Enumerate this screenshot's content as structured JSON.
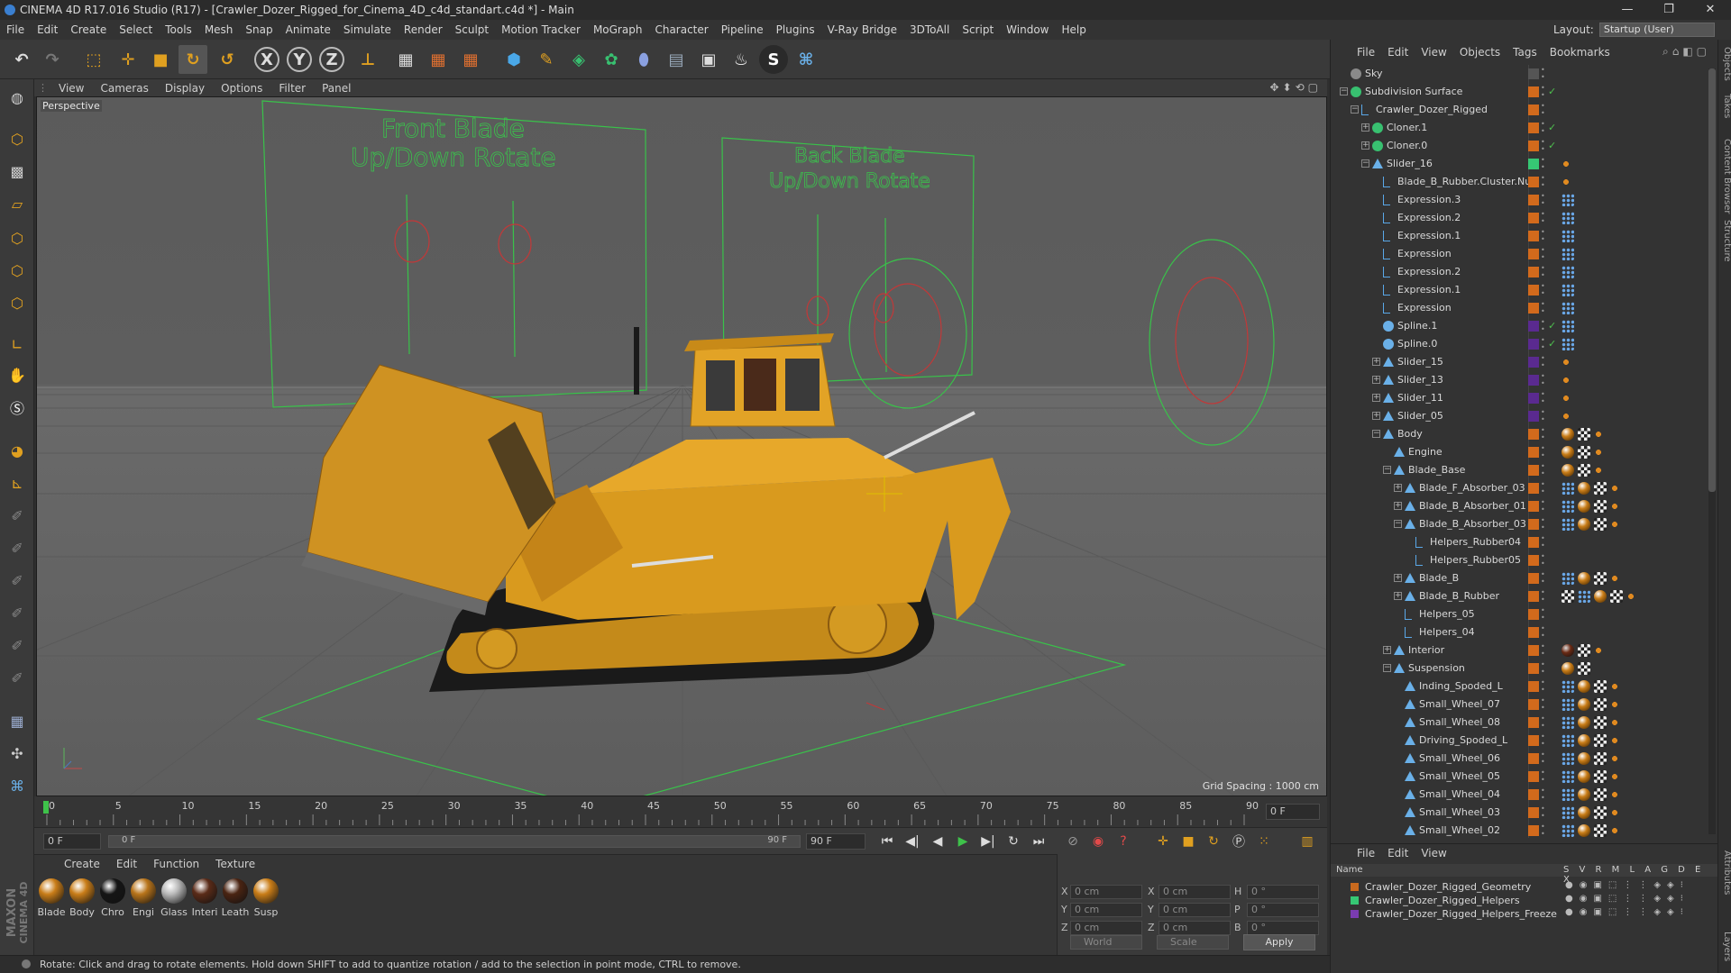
{
  "window": {
    "title": "CINEMA 4D R17.016 Studio (R17) - [Crawler_Dozer_Rigged_for_Cinema_4D_c4d_standart.c4d *] - Main",
    "controls": [
      "—",
      "❐",
      "✕"
    ]
  },
  "menubar": {
    "items": [
      "File",
      "Edit",
      "Create",
      "Select",
      "Tools",
      "Mesh",
      "Snap",
      "Animate",
      "Simulate",
      "Render",
      "Sculpt",
      "Motion Tracker",
      "MoGraph",
      "Character",
      "Pipeline",
      "Plugins",
      "V-Ray Bridge",
      "3DToAll",
      "Script",
      "Window",
      "Help"
    ]
  },
  "layout": {
    "label": "Layout:",
    "value": "Startup (User)"
  },
  "toolbar": {
    "axis_x": "X",
    "axis_y": "Y",
    "axis_z": "Z"
  },
  "viewport": {
    "menu": [
      "View",
      "Cameras",
      "Display",
      "Options",
      "Filter",
      "Panel"
    ],
    "label": "Perspective",
    "grid_spacing": "Grid Spacing : 1000 cm",
    "front_blade_line1": "Front Blade",
    "front_blade_line2": "Up/Down   Rotate",
    "back_blade_line1": "Back Blade",
    "back_blade_line2": "Up/Down   Rotate"
  },
  "timeline": {
    "ticks": [
      "0",
      "5",
      "10",
      "15",
      "20",
      "25",
      "30",
      "35",
      "40",
      "45",
      "50",
      "55",
      "60",
      "65",
      "70",
      "75",
      "80",
      "85",
      "90"
    ],
    "current_frame": "0 F"
  },
  "transport": {
    "start": "0 F",
    "range_start": "0 F",
    "range_end": "90 F",
    "end": "90 F"
  },
  "materials": {
    "menu": [
      "Create",
      "Edit",
      "Function",
      "Texture"
    ],
    "items": [
      {
        "name": "Blade",
        "color": "#c97d18"
      },
      {
        "name": "Body",
        "color": "#c97d18"
      },
      {
        "name": "Chro",
        "color": "#151515"
      },
      {
        "name": "Engi",
        "color": "#b8741a"
      },
      {
        "name": "Glass",
        "color": "#b9b9b9"
      },
      {
        "name": "Interi",
        "color": "#5a2b18"
      },
      {
        "name": "Leath",
        "color": "#4a2412"
      },
      {
        "name": "Susp",
        "color": "#c97d18"
      }
    ]
  },
  "coordinates": {
    "rows": [
      {
        "a": "X",
        "av": "0 cm",
        "b": "X",
        "bv": "0 cm",
        "c": "H",
        "cv": "0 °"
      },
      {
        "a": "Y",
        "av": "0 cm",
        "b": "Y",
        "bv": "0 cm",
        "c": "P",
        "cv": "0 °"
      },
      {
        "a": "Z",
        "av": "0 cm",
        "b": "Z",
        "bv": "0 cm",
        "c": "B",
        "cv": "0 °"
      }
    ],
    "mode": "World",
    "transform": "Scale",
    "apply": "Apply"
  },
  "status": "Rotate: Click and drag to rotate elements. Hold down SHIFT to add to quantize rotation / add to the selection in point mode, CTRL to remove.",
  "branding": {
    "maxon": "MAXON",
    "cinema": "CINEMA 4D"
  },
  "objects": {
    "menu": [
      "File",
      "Edit",
      "View",
      "Objects",
      "Tags",
      "Bookmarks"
    ],
    "items": [
      {
        "name": "Sky",
        "indent": 0,
        "exp": "",
        "icon": "sky",
        "tags": []
      },
      {
        "name": "Subdivision Surface",
        "indent": 0,
        "exp": "−",
        "icon": "subd",
        "check": "✓",
        "tags": []
      },
      {
        "name": "Crawler_Dozer_Rigged",
        "indent": 1,
        "exp": "−",
        "icon": "null",
        "tags": []
      },
      {
        "name": "Cloner.1",
        "indent": 2,
        "exp": "+",
        "icon": "cloner",
        "check": "✓",
        "tags": []
      },
      {
        "name": "Cloner.0",
        "indent": 2,
        "exp": "+",
        "icon": "cloner",
        "check": "✓",
        "tags": []
      },
      {
        "name": "Slider_16",
        "indent": 2,
        "exp": "−",
        "icon": "joint",
        "tags": [
          "xp"
        ]
      },
      {
        "name": "Blade_B_Rubber.Cluster.Null",
        "indent": 3,
        "exp": "",
        "icon": "null",
        "tags": [
          "xp"
        ]
      },
      {
        "name": "Expression.3",
        "indent": 3,
        "exp": "",
        "icon": "null",
        "tags": [
          "dots"
        ]
      },
      {
        "name": "Expression.2",
        "indent": 3,
        "exp": "",
        "icon": "null",
        "tags": [
          "dots"
        ]
      },
      {
        "name": "Expression.1",
        "indent": 3,
        "exp": "",
        "icon": "null",
        "tags": [
          "dots"
        ]
      },
      {
        "name": "Expression",
        "indent": 3,
        "exp": "",
        "icon": "null",
        "tags": [
          "dots"
        ]
      },
      {
        "name": "Expression.2",
        "indent": 3,
        "exp": "",
        "icon": "null",
        "tags": [
          "dots"
        ]
      },
      {
        "name": "Expression.1",
        "indent": 3,
        "exp": "",
        "icon": "null",
        "tags": [
          "dots"
        ]
      },
      {
        "name": "Expression",
        "indent": 3,
        "exp": "",
        "icon": "null",
        "tags": [
          "dots"
        ]
      },
      {
        "name": "Spline.1",
        "indent": 3,
        "exp": "",
        "icon": "spline",
        "check": "✓",
        "tags": [
          "dots"
        ]
      },
      {
        "name": "Spline.0",
        "indent": 3,
        "exp": "",
        "icon": "spline",
        "check": "✓",
        "tags": [
          "dots"
        ]
      },
      {
        "name": "Slider_15",
        "indent": 3,
        "exp": "+",
        "icon": "joint",
        "tags": [
          "xp"
        ]
      },
      {
        "name": "Slider_13",
        "indent": 3,
        "exp": "+",
        "icon": "joint",
        "tags": [
          "xp"
        ]
      },
      {
        "name": "Slider_11",
        "indent": 3,
        "exp": "+",
        "icon": "joint",
        "tags": [
          "xp"
        ]
      },
      {
        "name": "Slider_05",
        "indent": 3,
        "exp": "+",
        "icon": "joint",
        "tags": [
          "xp"
        ]
      },
      {
        "name": "Body",
        "indent": 3,
        "exp": "−",
        "icon": "joint",
        "tags": [
          "mat",
          "chk",
          "xp"
        ]
      },
      {
        "name": "Engine",
        "indent": 4,
        "exp": "",
        "icon": "joint",
        "tags": [
          "mat",
          "chk",
          "xp"
        ]
      },
      {
        "name": "Blade_Base",
        "indent": 4,
        "exp": "−",
        "icon": "joint",
        "tags": [
          "mat",
          "chk",
          "xp"
        ]
      },
      {
        "name": "Blade_F_Absorber_03",
        "indent": 5,
        "exp": "+",
        "icon": "joint",
        "tags": [
          "dots",
          "mat",
          "chk",
          "xp"
        ]
      },
      {
        "name": "Blade_B_Absorber_01",
        "indent": 5,
        "exp": "+",
        "icon": "joint",
        "tags": [
          "dots",
          "mat",
          "chk",
          "xp"
        ]
      },
      {
        "name": "Blade_B_Absorber_03",
        "indent": 5,
        "exp": "−",
        "icon": "joint",
        "tags": [
          "dots",
          "mat",
          "chk",
          "xp"
        ]
      },
      {
        "name": "Helpers_Rubber04",
        "indent": 6,
        "exp": "",
        "icon": "null",
        "tags": []
      },
      {
        "name": "Helpers_Rubber05",
        "indent": 6,
        "exp": "",
        "icon": "null",
        "tags": []
      },
      {
        "name": "Blade_B",
        "indent": 5,
        "exp": "+",
        "icon": "joint",
        "tags": [
          "dots",
          "mat",
          "chk",
          "xp"
        ]
      },
      {
        "name": "Blade_B_Rubber",
        "indent": 5,
        "exp": "+",
        "icon": "joint",
        "tags": [
          "chk",
          "dots",
          "mat",
          "chk",
          "xp"
        ]
      },
      {
        "name": "Helpers_05",
        "indent": 5,
        "exp": "",
        "icon": "null",
        "tags": []
      },
      {
        "name": "Helpers_04",
        "indent": 5,
        "exp": "",
        "icon": "null",
        "tags": []
      },
      {
        "name": "Interior",
        "indent": 4,
        "exp": "+",
        "icon": "joint",
        "tags": [
          "mat2",
          "chk",
          "xp"
        ]
      },
      {
        "name": "Suspension",
        "indent": 4,
        "exp": "−",
        "icon": "joint",
        "tags": [
          "mat",
          "chk"
        ]
      },
      {
        "name": "Inding_Spoded_L",
        "indent": 5,
        "exp": "",
        "icon": "joint",
        "tags": [
          "dots",
          "mat",
          "chk",
          "xp"
        ]
      },
      {
        "name": "Small_Wheel_07",
        "indent": 5,
        "exp": "",
        "icon": "joint",
        "tags": [
          "dots",
          "mat",
          "chk",
          "xp"
        ]
      },
      {
        "name": "Small_Wheel_08",
        "indent": 5,
        "exp": "",
        "icon": "joint",
        "tags": [
          "dots",
          "mat",
          "chk",
          "xp"
        ]
      },
      {
        "name": "Driving_Spoded_L",
        "indent": 5,
        "exp": "",
        "icon": "joint",
        "tags": [
          "dots",
          "mat",
          "chk",
          "xp"
        ]
      },
      {
        "name": "Small_Wheel_06",
        "indent": 5,
        "exp": "",
        "icon": "joint",
        "tags": [
          "dots",
          "mat",
          "chk",
          "xp"
        ]
      },
      {
        "name": "Small_Wheel_05",
        "indent": 5,
        "exp": "",
        "icon": "joint",
        "tags": [
          "dots",
          "mat",
          "chk",
          "xp"
        ]
      },
      {
        "name": "Small_Wheel_04",
        "indent": 5,
        "exp": "",
        "icon": "joint",
        "tags": [
          "dots",
          "mat",
          "chk",
          "xp"
        ]
      },
      {
        "name": "Small_Wheel_03",
        "indent": 5,
        "exp": "",
        "icon": "joint",
        "tags": [
          "dots",
          "mat",
          "chk",
          "xp"
        ]
      },
      {
        "name": "Small_Wheel_02",
        "indent": 5,
        "exp": "",
        "icon": "joint",
        "tags": [
          "dots",
          "mat",
          "chk",
          "xp"
        ]
      }
    ]
  },
  "layers": {
    "menu": [
      "File",
      "Edit",
      "View"
    ],
    "header": {
      "name": "Name",
      "flags": "S V R M L A G D E X"
    },
    "items": [
      {
        "name": "Crawler_Dozer_Rigged_Geometry",
        "color": "#c96a1e"
      },
      {
        "name": "Crawler_Dozer_Rigged_Helpers",
        "color": "#36c774"
      },
      {
        "name": "Crawler_Dozer_Rigged_Helpers_Freeze",
        "color": "#7a3cb0"
      }
    ]
  },
  "side_tabs": [
    "Objects",
    "Takes",
    "Content Browser",
    "Structure",
    "Attributes",
    "Layers"
  ]
}
